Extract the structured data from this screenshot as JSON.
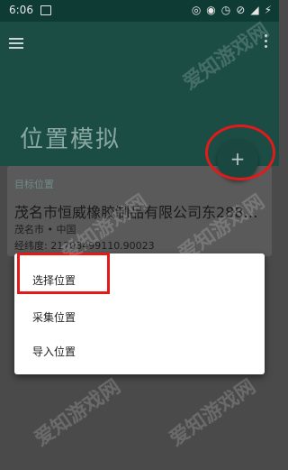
{
  "status_bar": {
    "time": "6:06"
  },
  "header": {
    "title": "位置模拟",
    "fab_label": "+"
  },
  "card": {
    "label": "目标位置",
    "place_name": "茂名市恒威橡胶制品有限公司东288…",
    "sub": "茂名市 • 中国",
    "coords": "经纬度: 21703499110.90023"
  },
  "menu": {
    "items": [
      "选择位置",
      "采集位置",
      "导入位置"
    ]
  },
  "watermark": {
    "text": "爱知游戏网"
  },
  "colors": {
    "header_bg": "#1b4d45",
    "annotation": "#e11a1a"
  }
}
